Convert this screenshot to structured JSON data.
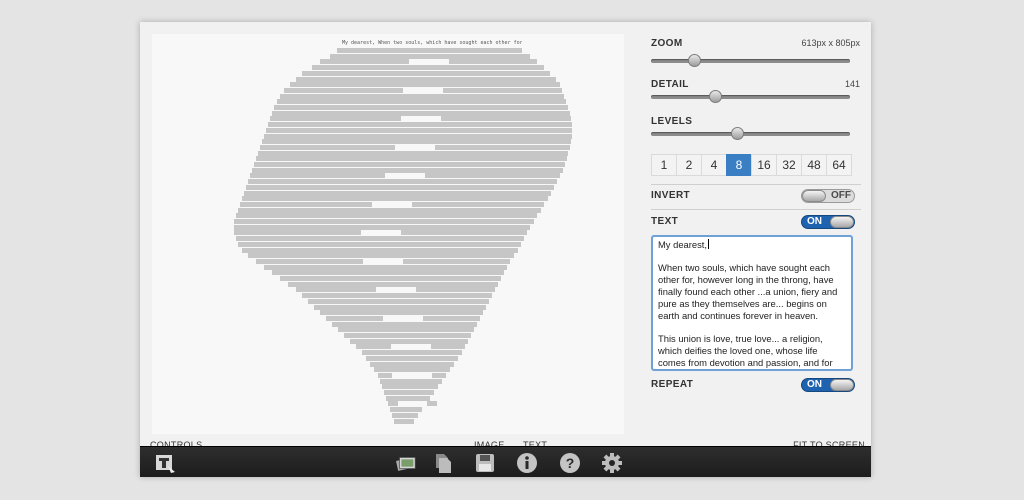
{
  "zoom": {
    "label": "ZOOM",
    "value": "613px x 805px",
    "level": 0.2
  },
  "detail": {
    "label": "DETAIL",
    "value": "141",
    "level": 0.31
  },
  "levels": {
    "label": "LEVELS",
    "level": 0.43,
    "options": [
      "1",
      "2",
      "4",
      "8",
      "16",
      "32",
      "48",
      "64"
    ],
    "selected": "8"
  },
  "invert": {
    "label": "INVERT",
    "state": "OFF"
  },
  "text": {
    "label": "TEXT",
    "state": "ON",
    "greeting": "My dearest,",
    "paragraph1": "When two souls, which have sought each other for, however long in the throng, have finally found each other ...a union, fiery and pure as they themselves are... begins on earth and continues forever in heaven.",
    "paragraph2": "This union is love, true love... a religion, which deifies the loved one, whose life comes from devotion and passion, and for which the greatest sacrifices are the sweetest delights."
  },
  "repeat": {
    "label": "REPEAT",
    "state": "ON"
  },
  "footer": {
    "controls": "CONTROLS",
    "image_tab": "IMAGE",
    "text_tab": "TEXT",
    "fit_to_screen": "FIT TO SCREEN"
  },
  "art_caption": "My dearest,     When two souls, which have sought each other for, however long in the thro",
  "toolbar": [
    "app-logo-icon",
    "images-icon",
    "copy-icon",
    "save-icon",
    "info-icon",
    "help-icon",
    "gear-icon"
  ],
  "colors": {
    "accent": "#3a7fc4",
    "toggle_on": "#1e62b0",
    "toolbar": "#262626"
  }
}
